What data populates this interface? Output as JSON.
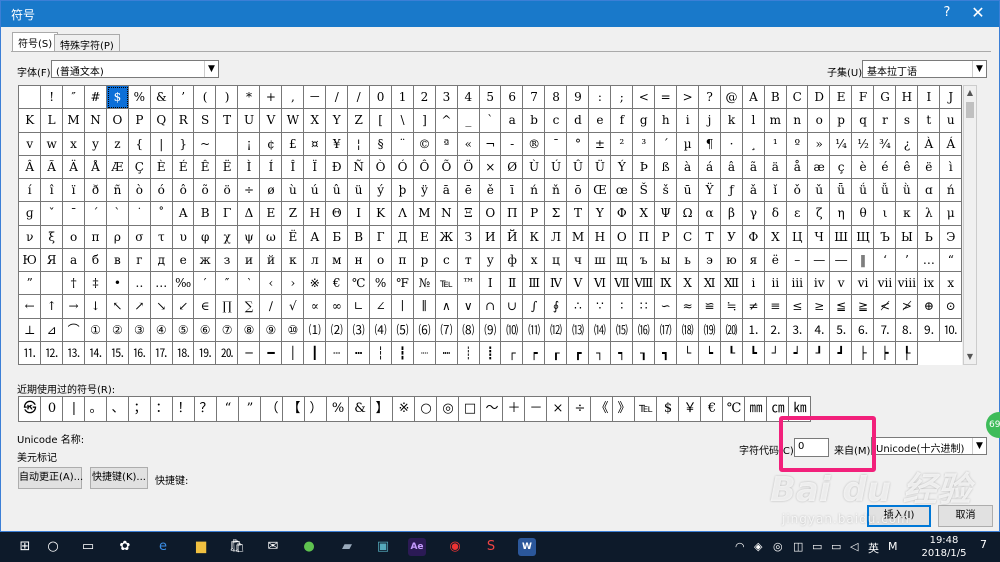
{
  "window": {
    "title": "符号",
    "help": "?",
    "close": "✕"
  },
  "tabs": [
    {
      "label": "符号(S)"
    },
    {
      "label": "特殊字符(P)"
    }
  ],
  "font": {
    "label": "字体(F):",
    "value": "(普通文本)"
  },
  "subset": {
    "label": "子集(U):",
    "value": "基本拉丁语"
  },
  "grid_rows": [
    [
      "",
      "!",
      "″",
      "#",
      "$",
      "%",
      "&",
      "’",
      "(",
      ")",
      "*",
      "+",
      ",",
      "－",
      "/",
      "/",
      "0",
      "1",
      "2",
      "3",
      "4",
      "5",
      "6",
      "7",
      "8",
      "9",
      ":",
      ";",
      "<",
      "=",
      ">",
      "?",
      "@",
      "A",
      "B",
      "C",
      "D",
      "E",
      "F",
      "G",
      "H",
      "I",
      "J"
    ],
    [
      "K",
      "L",
      "M",
      "N",
      "O",
      "P",
      "Q",
      "R",
      "S",
      "T",
      "U",
      "V",
      "W",
      "X",
      "Y",
      "Z",
      "[",
      "\\",
      "]",
      "^",
      "_",
      "`",
      "a",
      "b",
      "c",
      "d",
      "e",
      "f",
      "g",
      "h",
      "i",
      "j",
      "k",
      "l",
      "m",
      "n",
      "o",
      "p",
      "q",
      "r",
      "s",
      "t",
      "u"
    ],
    [
      "v",
      "w",
      "x",
      "y",
      "z",
      "{",
      "|",
      "}",
      "~",
      "",
      "¡",
      "¢",
      "£",
      "¤",
      "¥",
      "¦",
      "§",
      "¨",
      "©",
      "ª",
      "«",
      "¬",
      "-",
      "®",
      "¯",
      "°",
      "±",
      "²",
      "³",
      "´",
      "µ",
      "¶",
      "·",
      "¸",
      "¹",
      "º",
      "»",
      "¼",
      "½",
      "¾",
      "¿",
      "À",
      "Á"
    ],
    [
      "Â",
      "Ã",
      "Ä",
      "Å",
      "Æ",
      "Ç",
      "È",
      "É",
      "Ê",
      "Ë",
      "Ì",
      "Í",
      "Î",
      "Ï",
      "Đ",
      "Ñ",
      "Ò",
      "Ó",
      "Ô",
      "Õ",
      "Ö",
      "×",
      "Ø",
      "Ù",
      "Ú",
      "Û",
      "Ü",
      "Ý",
      "Þ",
      "ß",
      "à",
      "á",
      "â",
      "ã",
      "ä",
      "å",
      "æ",
      "ç",
      "è",
      "é",
      "ê",
      "ë",
      "ì"
    ],
    [
      "í",
      "î",
      "ï",
      "ð",
      "ñ",
      "ò",
      "ó",
      "ô",
      "õ",
      "ö",
      "÷",
      "ø",
      "ù",
      "ú",
      "û",
      "ü",
      "ý",
      "þ",
      "ÿ",
      "ā",
      "ē",
      "ě",
      "ī",
      "ń",
      "ň",
      "ō",
      "Œ",
      "œ",
      "Š",
      "š",
      "ū",
      "Ÿ",
      "ƒ",
      "ǎ",
      "ǐ",
      "ǒ",
      "ǔ",
      "ǖ",
      "ǘ",
      "ǚ",
      "ǜ",
      "ɑ",
      "ń"
    ],
    [
      "ɡ",
      "ˇ",
      "ˉ",
      "ˊ",
      "ˋ",
      "˙",
      "˚",
      "Α",
      "Β",
      "Γ",
      "Δ",
      "Ε",
      "Ζ",
      "Η",
      "Θ",
      "Ι",
      "Κ",
      "Λ",
      "Μ",
      "Ν",
      "Ξ",
      "Ο",
      "Π",
      "Ρ",
      "Σ",
      "Τ",
      "Υ",
      "Φ",
      "Χ",
      "Ψ",
      "Ω",
      "α",
      "β",
      "γ",
      "δ",
      "ε",
      "ζ",
      "η",
      "θ",
      "ι",
      "κ",
      "λ"
    ],
    [
      "μ",
      "ν",
      "ξ",
      "ο",
      "π",
      "ρ",
      "σ",
      "τ",
      "υ",
      "φ",
      "χ",
      "ψ",
      "ω",
      "Ё",
      "А",
      "Б",
      "В",
      "Г",
      "Д",
      "Е",
      "Ж",
      "З",
      "И",
      "Й",
      "К",
      "Л",
      "М",
      "Н",
      "О",
      "П",
      "Р",
      "С",
      "Т",
      "У",
      "Ф",
      "Х",
      "Ц",
      "Ч",
      "Ш",
      "Щ",
      "Ъ",
      "Ы",
      "Ь"
    ],
    [
      "Э",
      "Ю",
      "Я",
      "а",
      "б",
      "в",
      "г",
      "д",
      "е",
      "ж",
      "з",
      "и",
      "й",
      "к",
      "л",
      "м",
      "н",
      "о",
      "п",
      "р",
      "с",
      "т",
      "у",
      "ф",
      "х",
      "ц",
      "ч",
      "ш",
      "щ",
      "ъ",
      "ы",
      "ь",
      "э",
      "ю",
      "я",
      "ё",
      "–",
      "—",
      "―",
      "‖",
      "‘",
      "’"
    ],
    [
      "…",
      "“",
      "”",
      "",
      "†",
      "‡",
      "•",
      "‥",
      "…",
      "‰",
      "′",
      "″",
      "‵",
      "‹",
      "›",
      "※",
      "€",
      "℃",
      "%",
      "℉",
      "№",
      "℡",
      "™",
      "Ⅰ",
      "Ⅱ",
      "Ⅲ",
      "Ⅳ",
      "Ⅴ",
      "Ⅵ",
      "Ⅶ",
      "Ⅷ",
      "Ⅸ",
      "Ⅹ",
      "Ⅺ",
      "Ⅻ",
      "ⅰ",
      "ⅱ",
      "ⅲ",
      "ⅳ",
      "ⅴ",
      "ⅵ",
      "ⅶ",
      "ⅷ"
    ],
    [
      "ⅸ",
      "ⅹ",
      "←",
      "↑",
      "→",
      "↓",
      "↖",
      "↗",
      "↘",
      "↙",
      "∈",
      "∏",
      "∑",
      "∕",
      "√",
      "∝",
      "∞",
      "∟",
      "∠",
      "∣",
      "∥",
      "∧",
      "∨",
      "∩",
      "∪",
      "∫",
      "∮",
      "∴",
      "∵",
      "∶",
      "∷",
      "∽",
      "≈",
      "≌",
      "≒",
      "≠",
      "≡",
      "≤",
      "≥",
      "≦",
      "≧",
      "≮",
      "≯"
    ],
    [
      "⊕",
      "⊙",
      "⊥",
      "⊿",
      "⌒",
      "①",
      "②",
      "③",
      "④",
      "⑤",
      "⑥",
      "⑦",
      "⑧",
      "⑨",
      "⑩",
      "⑴",
      "⑵",
      "⑶",
      "⑷",
      "⑸",
      "⑹",
      "⑺",
      "⑻",
      "⑼",
      "⑽",
      "⑾",
      "⑿",
      "⒀",
      "⒁",
      "⒂",
      "⒃",
      "⒄",
      "⒅",
      "⒆",
      "⒇",
      "⒈",
      "⒉",
      "⒊",
      "⒋",
      "⒌",
      "⒍",
      "⒎",
      "⒏"
    ],
    [
      "⒐",
      "⒑",
      "⒒",
      "⒓",
      "⒔",
      "⒕",
      "⒖",
      "⒗",
      "⒘",
      "⒙",
      "⒚",
      "⒛",
      "─",
      "━",
      "│",
      "┃",
      "┄",
      "┅",
      "┆",
      "┇",
      "┈",
      "┉",
      "┊",
      "┋",
      "┌",
      "┍",
      "┎",
      "┏",
      "┐",
      "┑",
      "┒",
      "┓",
      "└",
      "┕",
      "┖",
      "┗",
      "┘",
      "┙",
      "┚",
      "┛",
      "├",
      "┝",
      "┞"
    ]
  ],
  "recent": {
    "label": "近期使用过的符号(R):",
    "symbols": [
      "㉿",
      "0",
      "|",
      "。",
      "、",
      "；",
      "：",
      "！",
      "？",
      "“",
      "”",
      "（",
      "【",
      "）",
      "%",
      "&",
      "】",
      "※",
      "○",
      "◎",
      "□",
      "～",
      "＋",
      "－",
      "×",
      "÷",
      "《",
      "》",
      "℡",
      "$",
      "￥",
      "€",
      "℃",
      "㎜",
      "㎝",
      "㎞"
    ]
  },
  "unicode": {
    "name_label": "Unicode 名称:",
    "name_value": "美元标记"
  },
  "charcode": {
    "label": "字符代码(C):",
    "value": "0",
    "from_label": "来自(M):",
    "from_value": "Unicode(十六进制)"
  },
  "buttons": {
    "autocorrect": "自动更正(A)...",
    "shortcut_key": "快捷键(K)...",
    "shortcut_label": "快捷键:",
    "insert": "插入(I)",
    "cancel": "取消"
  },
  "watermark": {
    "brand": "Bai du 经验",
    "url": "jingyan.baidu.com"
  },
  "side_bubble": "69",
  "taskbar": {
    "apps": [
      "Ae",
      "W"
    ],
    "ime": "英",
    "ime2": "M",
    "time": "19:48",
    "date": "2018/1/5",
    "notify": "7"
  },
  "colors": {
    "titlebar": "#1979ca",
    "selected_cell": "#0c6fd8",
    "highlight_box": "#f2207b",
    "taskbar": "#0d1a2a"
  }
}
